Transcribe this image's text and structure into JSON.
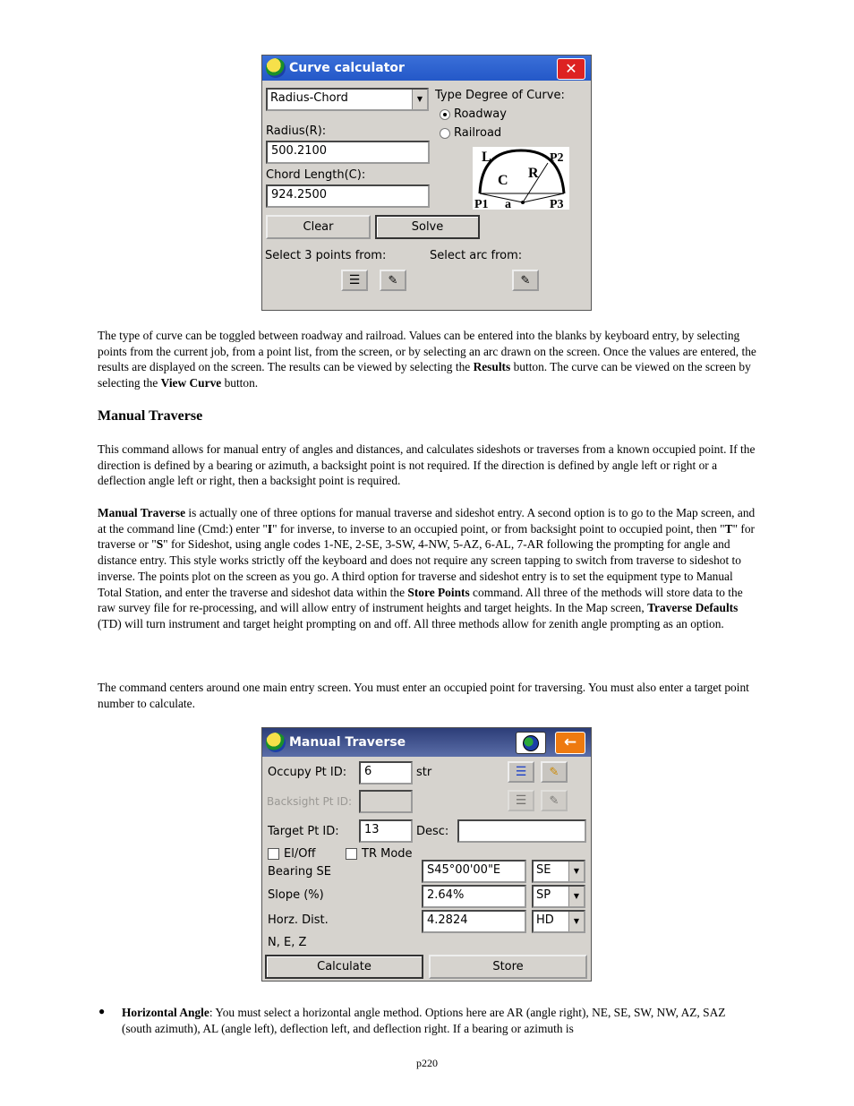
{
  "curve_calculator": {
    "title": "Curve calculator",
    "mode_select": "Radius-Chord",
    "type_label": "Type Degree of Curve:",
    "radio_roadway": "Roadway",
    "radio_railroad": "Railroad",
    "selected_type": "Roadway",
    "radius_label": "Radius(R):",
    "radius_value": "500.2100",
    "chord_label": "Chord Length(C):",
    "chord_value": "924.2500",
    "clear_label": "Clear",
    "solve_label": "Solve",
    "select_points_label": "Select 3 points from:",
    "select_arc_label": "Select arc from:",
    "diagram_labels": {
      "L": "L",
      "C": "C",
      "R": "R",
      "a": "a",
      "P1": "P1",
      "P2": "P2",
      "P3": "P3"
    }
  },
  "paragraph1": {
    "text1": "The type of curve can be toggled between roadway and railroad. Values can be entered into the blanks by keyboard entry, by selecting points from the current job, from a point list, from the screen, or by selecting an arc drawn on the screen. Once the values are entered, the results are displayed on the screen. The results can be viewed by selecting the ",
    "bold1": "Results",
    "text2": " button. The curve can be viewed on the screen by selecting the ",
    "bold2": "View Curve",
    "text3": " button."
  },
  "heading": "Manual Traverse",
  "paragraph2": "This command allows for manual entry of angles and distances, and calculates sideshots or traverses from a known occupied point.  If the direction is defined by a bearing or azimuth, a backsight point is not required.  If the direction is defined by angle left or right or a deflection angle left or right, then a backsight point is required.",
  "paragraph3": {
    "bold1": "Manual Traverse",
    "text1": " is actually one of three options for manual traverse and sideshot entry.  A second option is to go to the Map screen, and at the command line (Cmd:) enter \"",
    "bold_I": "I",
    "text2": "\" for inverse, to inverse to an occupied point, or from backsight point to occupied point, then \"",
    "bold_T": "T",
    "text3": "\" for traverse or \"",
    "bold_S": "S",
    "text4": "\" for Sideshot, using angle codes 1-NE, 2-SE, 3-SW, 4-NW, 5-AZ, 6-AL, 7-AR following the prompting for angle and distance entry.  This style works strictly off the keyboard and does not require any screen tapping to switch from traverse to sideshot to inverse.  The points plot on the screen as you go.  A third option for traverse and sideshot entry is to set the equipment type to Manual Total Station, and enter the traverse and sideshot data within the ",
    "bold2": "Store Points",
    "text5": " command.  All three of the methods will store data to the raw survey file for re-processing, and will allow entry of instrument heights and target heights.  In the Map screen, ",
    "bold3": "Traverse Defaults",
    "text6": " (TD) will turn instrument and target height prompting on and off.  All three methods allow for zenith angle prompting as an option."
  },
  "paragraph4": "The command centers around one main entry screen. You must enter an occupied point for traversing. You must also enter a target point number to calculate.",
  "manual_traverse": {
    "title": "Manual Traverse",
    "occupy_label": "Occupy Pt ID:",
    "occupy_value": "6",
    "occupy_suffix": "str",
    "backsight_label": "Backsight Pt ID:",
    "backsight_value": "",
    "target_label": "Target Pt ID:",
    "target_value": "13",
    "desc_label": "Desc:",
    "desc_value": "",
    "eloff_label": "El/Off",
    "trmode_label": "TR Mode",
    "bearing_label": "Bearing SE",
    "bearing_value": "S45°00'00\"E",
    "bearing_mode": "SE",
    "slope_label": "Slope (%)",
    "slope_value": "2.64%",
    "slope_mode": "SP",
    "horz_label": "Horz. Dist.",
    "horz_value": "4.2824",
    "horz_mode": "HD",
    "nez_label": "N, E, Z",
    "calculate_label": "Calculate",
    "store_label": "Store"
  },
  "bullet": {
    "bold": "Horizontal Angle",
    "text": ":  You must select a horizontal angle method.  Options here are AR (angle right), NE, SE, SW, NW, AZ, SAZ (south azimuth), AL (angle left), deflection left, and deflection right.  If a bearing or azimuth is"
  },
  "page_number": "p220"
}
